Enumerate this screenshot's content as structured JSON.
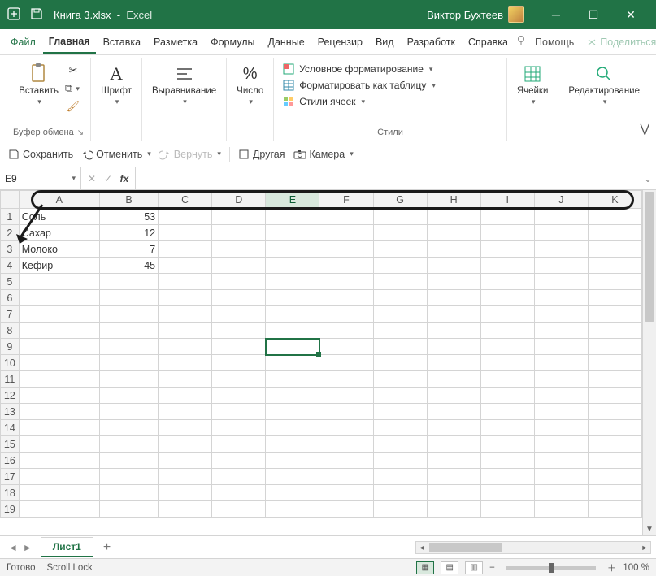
{
  "titlebar": {
    "filename": "Книга 3.xlsx",
    "separator": "-",
    "app": "Excel",
    "user": "Виктор Бухтеев"
  },
  "menu": {
    "file": "Файл",
    "home": "Главная",
    "insert": "Вставка",
    "layout": "Разметка",
    "formulas": "Формулы",
    "data": "Данные",
    "review": "Рецензир",
    "view": "Вид",
    "developer": "Разработк",
    "help": "Справка",
    "help_right": "Помощь",
    "share": "Поделиться"
  },
  "ribbon": {
    "paste": "Вставить",
    "clipboard": "Буфер обмена",
    "font": "Шрифт",
    "align": "Выравнивание",
    "number": "Число",
    "cond_format": "Условное форматирование",
    "format_table": "Форматировать как таблицу",
    "cell_styles": "Стили ячеек",
    "styles": "Стили",
    "cells": "Ячейки",
    "editing": "Редактирование"
  },
  "qat": {
    "save": "Сохранить",
    "undo": "Отменить",
    "redo": "Вернуть",
    "other": "Другая",
    "camera": "Камера"
  },
  "namebox": "E9",
  "columns": [
    "A",
    "B",
    "C",
    "D",
    "E",
    "F",
    "G",
    "H",
    "I",
    "J",
    "K"
  ],
  "rows_visible": 19,
  "sel": {
    "col": "E",
    "row": 9
  },
  "cells": {
    "A1": "Соль",
    "B1": "53",
    "A2": "Сахар",
    "B2": "12",
    "A3": "Молоко",
    "B3": "7",
    "A4": "Кефир",
    "B4": "45"
  },
  "sheettab": "Лист1",
  "status": {
    "ready": "Готово",
    "scroll": "Scroll Lock",
    "zoom": "100 %"
  }
}
